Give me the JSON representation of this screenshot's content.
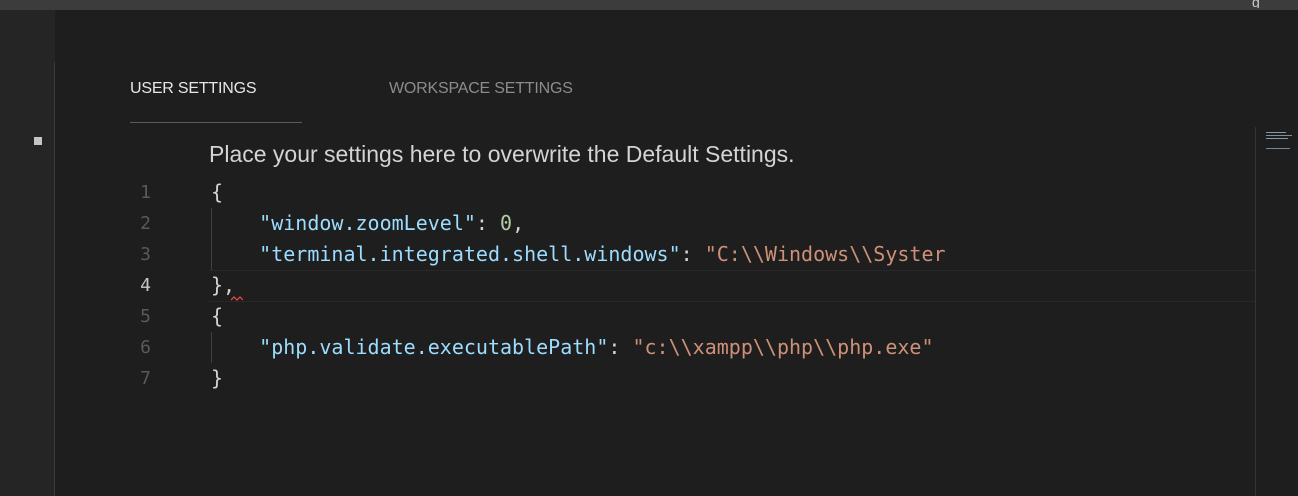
{
  "tabs": [
    {
      "label": "USER SETTINGS",
      "active": true
    },
    {
      "label": "WORKSPACE SETTINGS",
      "active": false
    }
  ],
  "editor": {
    "banner": "Place your settings here to overwrite the Default Settings.",
    "current_line": 4,
    "lines": [
      {
        "number": "1",
        "text": "{"
      },
      {
        "number": "2",
        "text": "    \"window.zoomLevel\": 0,"
      },
      {
        "number": "3",
        "text": "    \"terminal.integrated.shell.windows\": \"C:\\\\Windows\\\\Syster"
      },
      {
        "number": "4",
        "text": "},"
      },
      {
        "number": "5",
        "text": "{"
      },
      {
        "number": "6",
        "text": "    \"php.validate.executablePath\": \"c:\\\\xampp\\\\php\\\\php.exe\""
      },
      {
        "number": "7",
        "text": "}"
      }
    ]
  },
  "colors": {
    "background": "#1e1e1e",
    "json_key": "#9cdcfe",
    "json_string": "#ce9178",
    "json_number": "#b5cea8",
    "error_squiggle": "#f14c4c"
  },
  "icons": [
    "fold-indicator-icon",
    "error-squiggle-icon"
  ]
}
